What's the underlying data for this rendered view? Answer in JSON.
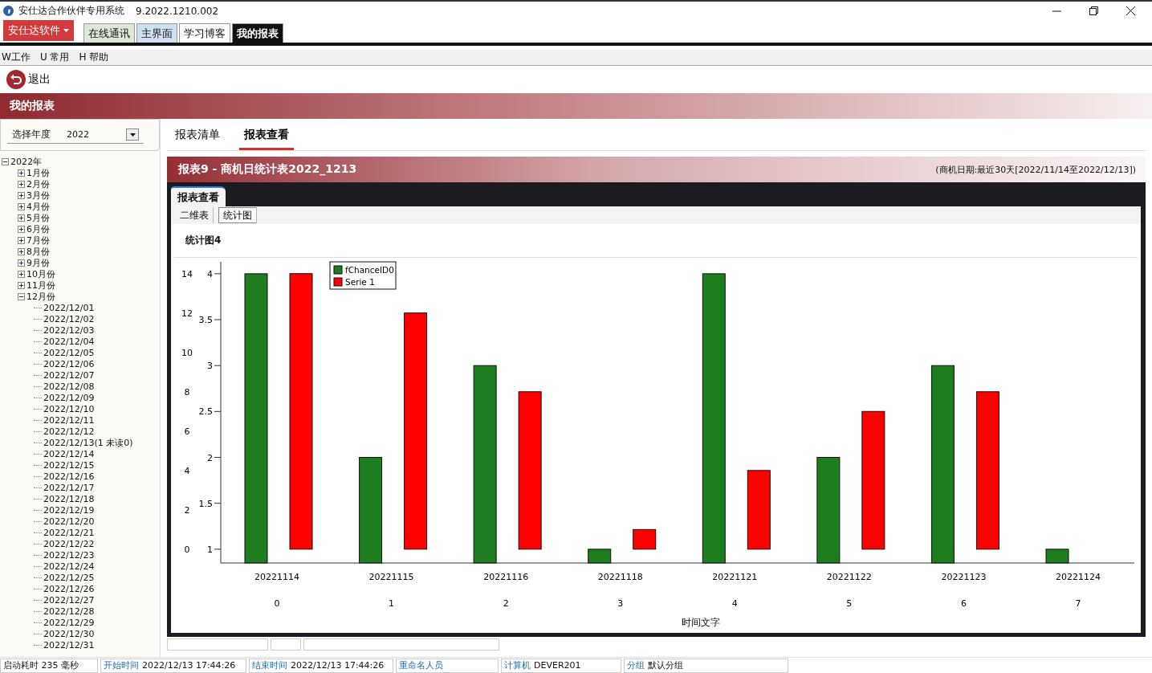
{
  "window": {
    "title": "安仕达合作伙伴专用系统",
    "version": "9.2022.1210.002"
  },
  "app_menu": {
    "label": "安仕达软件"
  },
  "top_tabs": [
    {
      "label": "在线通讯",
      "selected": false,
      "color": "#dde8d8"
    },
    {
      "label": "主界面",
      "selected": false,
      "color": "#cfe0f3"
    },
    {
      "label": "学习博客",
      "selected": false,
      "color": "#ffffff"
    },
    {
      "label": "我的报表",
      "selected": true,
      "color": "#111111"
    }
  ],
  "menu": [
    "W工作",
    "U 常用",
    "H 帮助"
  ],
  "toolbar": {
    "exit": "退出"
  },
  "page_header": "我的报表",
  "sidebar": {
    "year_label": "选择年度",
    "year_value": "2022",
    "tree": [
      {
        "label": "2022年",
        "expanded": true,
        "children": [
          {
            "label": "1月份",
            "expanded": false
          },
          {
            "label": "2月份",
            "expanded": false
          },
          {
            "label": "3月份",
            "expanded": false
          },
          {
            "label": "4月份",
            "expanded": false
          },
          {
            "label": "5月份",
            "expanded": false
          },
          {
            "label": "6月份",
            "expanded": false
          },
          {
            "label": "7月份",
            "expanded": false
          },
          {
            "label": "8月份",
            "expanded": false
          },
          {
            "label": "9月份",
            "expanded": false
          },
          {
            "label": "10月份",
            "expanded": false
          },
          {
            "label": "11月份",
            "expanded": false
          },
          {
            "label": "12月份",
            "expanded": true,
            "children": [
              {
                "label": "2022/12/01"
              },
              {
                "label": "2022/12/02"
              },
              {
                "label": "2022/12/03"
              },
              {
                "label": "2022/12/04"
              },
              {
                "label": "2022/12/05"
              },
              {
                "label": "2022/12/06"
              },
              {
                "label": "2022/12/07"
              },
              {
                "label": "2022/12/08"
              },
              {
                "label": "2022/12/09"
              },
              {
                "label": "2022/12/10"
              },
              {
                "label": "2022/12/11"
              },
              {
                "label": "2022/12/12"
              },
              {
                "label": "2022/12/13(1 未读0)"
              },
              {
                "label": "2022/12/14"
              },
              {
                "label": "2022/12/15"
              },
              {
                "label": "2022/12/16"
              },
              {
                "label": "2022/12/17"
              },
              {
                "label": "2022/12/18"
              },
              {
                "label": "2022/12/19"
              },
              {
                "label": "2022/12/20"
              },
              {
                "label": "2022/12/21"
              },
              {
                "label": "2022/12/22"
              },
              {
                "label": "2022/12/23"
              },
              {
                "label": "2022/12/24"
              },
              {
                "label": "2022/12/25"
              },
              {
                "label": "2022/12/26"
              },
              {
                "label": "2022/12/27"
              },
              {
                "label": "2022/12/28"
              },
              {
                "label": "2022/12/29"
              },
              {
                "label": "2022/12/30"
              },
              {
                "label": "2022/12/31"
              }
            ]
          }
        ]
      }
    ]
  },
  "view_tabs": [
    {
      "label": "报表清单",
      "selected": false
    },
    {
      "label": "报表查看",
      "selected": true
    }
  ],
  "report": {
    "title": "报表9 - 商机日统计表2022_1213",
    "range": "(商机日期:最近30天[2022/11/14至2022/12/13])",
    "panel_tab": "报表查看",
    "sub_tabs": [
      {
        "label": "二维表",
        "selected": false
      },
      {
        "label": "统计图",
        "selected": true
      }
    ],
    "chart_data": {
      "type": "bar",
      "title": "统计图4",
      "xlabel": "时间文字",
      "categories": [
        "20221114",
        "20221115",
        "20221116",
        "20221118",
        "20221121",
        "20221122",
        "20221123",
        "20221124"
      ],
      "legend": true,
      "ylim": [
        -0.7,
        14.6
      ],
      "y2lim": [
        0.85,
        4.13
      ],
      "yticks": [
        0,
        2,
        4,
        6,
        8,
        10,
        12,
        14
      ],
      "y2ticks": [
        {
          "value": 1,
          "label": "1"
        },
        {
          "value": 1.5,
          "label": "1.5"
        },
        {
          "value": 2,
          "label": "2"
        },
        {
          "value": 2.5,
          "label": "2.5"
        },
        {
          "value": 3,
          "label": "3"
        },
        {
          "value": 3.5,
          "label": "3.5"
        },
        {
          "value": 4,
          "label": "4"
        }
      ],
      "series": [
        {
          "name": "fChanceID0",
          "color": "#1e7d1e",
          "axis": "y2",
          "values": [
            4,
            2,
            3,
            1,
            4,
            2,
            3,
            1
          ]
        },
        {
          "name": "Serie 1",
          "color": "#ff0000",
          "axis": "y",
          "values": [
            14,
            12,
            8,
            1,
            4,
            7,
            8,
            null
          ]
        }
      ]
    },
    "x_index_labels": [
      "0",
      "1",
      "2",
      "3",
      "4",
      "5",
      "6",
      "7"
    ]
  },
  "status_bar": [
    {
      "text": "启动耗时 235 毫秒"
    },
    {
      "label": "开始时间",
      "value": "2022/12/13 17:44:26"
    },
    {
      "label": "结束时间",
      "value": "2022/12/13 17:44:26"
    },
    {
      "label": "重命名人员"
    },
    {
      "label": "计算机",
      "value": "DEVER201"
    },
    {
      "label": "分组",
      "value": "默认分组"
    }
  ]
}
